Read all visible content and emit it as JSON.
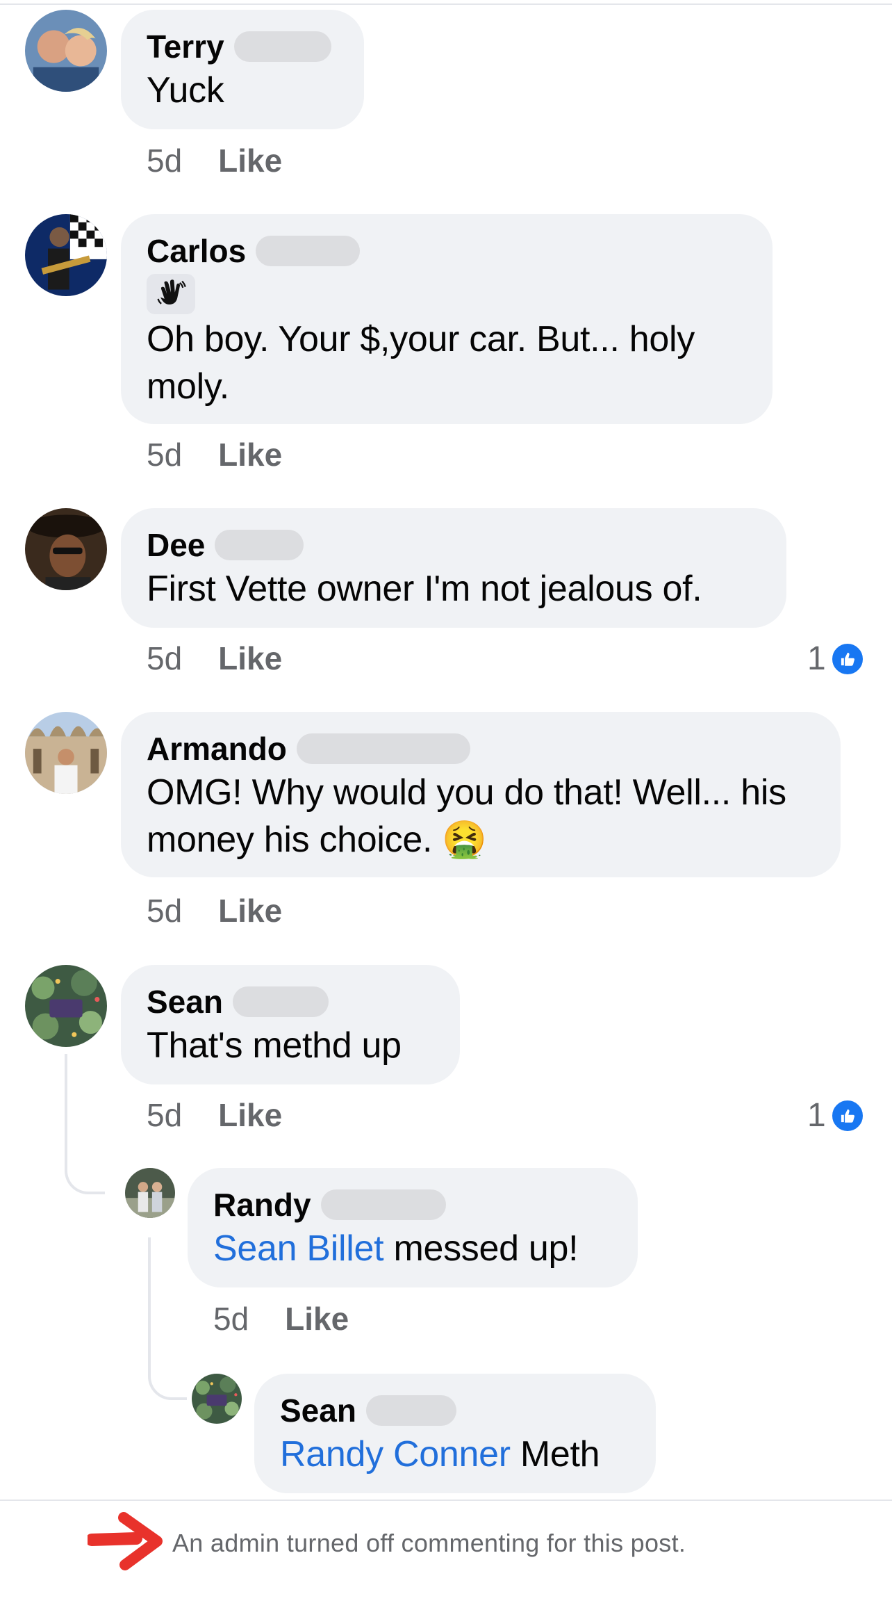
{
  "comments": [
    {
      "name": "Terry",
      "text": "Yuck",
      "time": "5d",
      "like": "Like"
    },
    {
      "name": "Carlos",
      "sticker_icon": "waving-hand-icon",
      "text": "Oh boy. Your $,your car. But... holy moly.",
      "time": "5d",
      "like": "Like"
    },
    {
      "name": "Dee",
      "text": "First Vette owner I'm not jealous of.",
      "time": "5d",
      "like": "Like",
      "reactions": "1"
    },
    {
      "name": "Armando",
      "text": "OMG!  Why would you do that!   Well... his money his choice.",
      "emoji": "🤮",
      "time": "5d",
      "like": "Like"
    },
    {
      "name": "Sean",
      "text": "That's methd up",
      "time": "5d",
      "like": "Like",
      "reactions": "1"
    }
  ],
  "replies": [
    {
      "name": "Randy",
      "mention": "Sean Billet",
      "text": " messed up!",
      "time": "5d",
      "like": "Like"
    },
    {
      "name": "Sean",
      "mention": "Randy Conner",
      "text": " Meth"
    }
  ],
  "footer": {
    "message": "An admin turned off commenting for this post.",
    "icon": "red-arrow-icon"
  },
  "colors": {
    "bubble": "#f0f2f5",
    "mention": "#216fdb",
    "meta": "#65676b",
    "like_blue": "#1877f2",
    "arrow": "#e8322b"
  }
}
